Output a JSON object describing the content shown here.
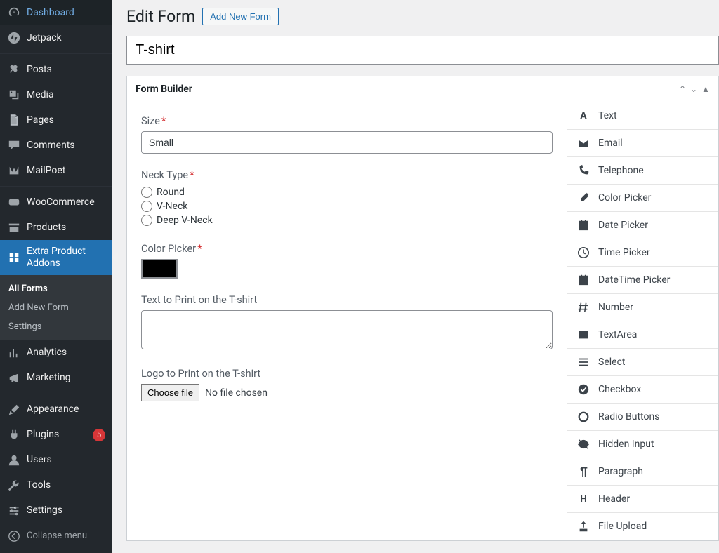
{
  "page": {
    "title": "Edit Form",
    "action": "Add New Form",
    "form_name": "T-shirt",
    "panel_title": "Form Builder"
  },
  "sidebar": [
    {
      "id": "dashboard",
      "label": "Dashboard",
      "icon": "gauge"
    },
    {
      "id": "jetpack",
      "label": "Jetpack",
      "icon": "jetpack"
    },
    {
      "spacer": true
    },
    {
      "id": "posts",
      "label": "Posts",
      "icon": "pin"
    },
    {
      "id": "media",
      "label": "Media",
      "icon": "media"
    },
    {
      "id": "pages",
      "label": "Pages",
      "icon": "page"
    },
    {
      "id": "comments",
      "label": "Comments",
      "icon": "comment"
    },
    {
      "id": "mailpoet",
      "label": "MailPoet",
      "icon": "mailpoet"
    },
    {
      "spacer": true
    },
    {
      "id": "woocommerce",
      "label": "WooCommerce",
      "icon": "woo"
    },
    {
      "id": "products",
      "label": "Products",
      "icon": "archive"
    },
    {
      "id": "epa",
      "label": "Extra Product Addons",
      "icon": "grid",
      "active": true,
      "sub": [
        {
          "id": "all-forms",
          "label": "All Forms",
          "current": true
        },
        {
          "id": "add-new-form",
          "label": "Add New Form"
        },
        {
          "id": "settings",
          "label": "Settings"
        }
      ]
    },
    {
      "id": "analytics",
      "label": "Analytics",
      "icon": "chart"
    },
    {
      "id": "marketing",
      "label": "Marketing",
      "icon": "megaphone"
    },
    {
      "spacer": true
    },
    {
      "id": "appearance",
      "label": "Appearance",
      "icon": "brush"
    },
    {
      "id": "plugins",
      "label": "Plugins",
      "icon": "plug",
      "badge": 5
    },
    {
      "id": "users",
      "label": "Users",
      "icon": "user"
    },
    {
      "id": "tools",
      "label": "Tools",
      "icon": "wrench"
    },
    {
      "id": "settings-main",
      "label": "Settings",
      "icon": "sliders"
    },
    {
      "id": "collapse",
      "label": "Collapse menu",
      "icon": "collapse",
      "collapse": true
    }
  ],
  "form": {
    "size": {
      "label": "Size",
      "required": true,
      "value": "Small"
    },
    "neck": {
      "label": "Neck Type",
      "required": true,
      "options": [
        "Round",
        "V-Neck",
        "Deep V-Neck"
      ]
    },
    "color": {
      "label": "Color Picker",
      "required": true,
      "value": "#000000"
    },
    "print_text": {
      "label": "Text to Print on the T-shirt",
      "value": ""
    },
    "logo": {
      "label": "Logo to Print on the T-shirt",
      "button": "Choose file",
      "status": "No file chosen"
    }
  },
  "palette": [
    {
      "id": "text",
      "label": "Text",
      "icon": "A"
    },
    {
      "id": "email",
      "label": "Email",
      "icon": "envelope"
    },
    {
      "id": "telephone",
      "label": "Telephone",
      "icon": "phone"
    },
    {
      "id": "colorpicker",
      "label": "Color Picker",
      "icon": "eyedropper"
    },
    {
      "id": "datepicker",
      "label": "Date Picker",
      "icon": "calendar"
    },
    {
      "id": "timepicker",
      "label": "Time Picker",
      "icon": "clock"
    },
    {
      "id": "datetimepicker",
      "label": "DateTime Picker",
      "icon": "calendar"
    },
    {
      "id": "number",
      "label": "Number",
      "icon": "hash"
    },
    {
      "id": "textarea",
      "label": "TextArea",
      "icon": "textarea"
    },
    {
      "id": "select",
      "label": "Select",
      "icon": "lines"
    },
    {
      "id": "checkbox",
      "label": "Checkbox",
      "icon": "checkcircle"
    },
    {
      "id": "radio",
      "label": "Radio Buttons",
      "icon": "ring"
    },
    {
      "id": "hidden",
      "label": "Hidden Input",
      "icon": "eye-off"
    },
    {
      "id": "paragraph",
      "label": "Paragraph",
      "icon": "pilcrow"
    },
    {
      "id": "header",
      "label": "Header",
      "icon": "H"
    },
    {
      "id": "fileupload",
      "label": "File Upload",
      "icon": "upload"
    }
  ]
}
